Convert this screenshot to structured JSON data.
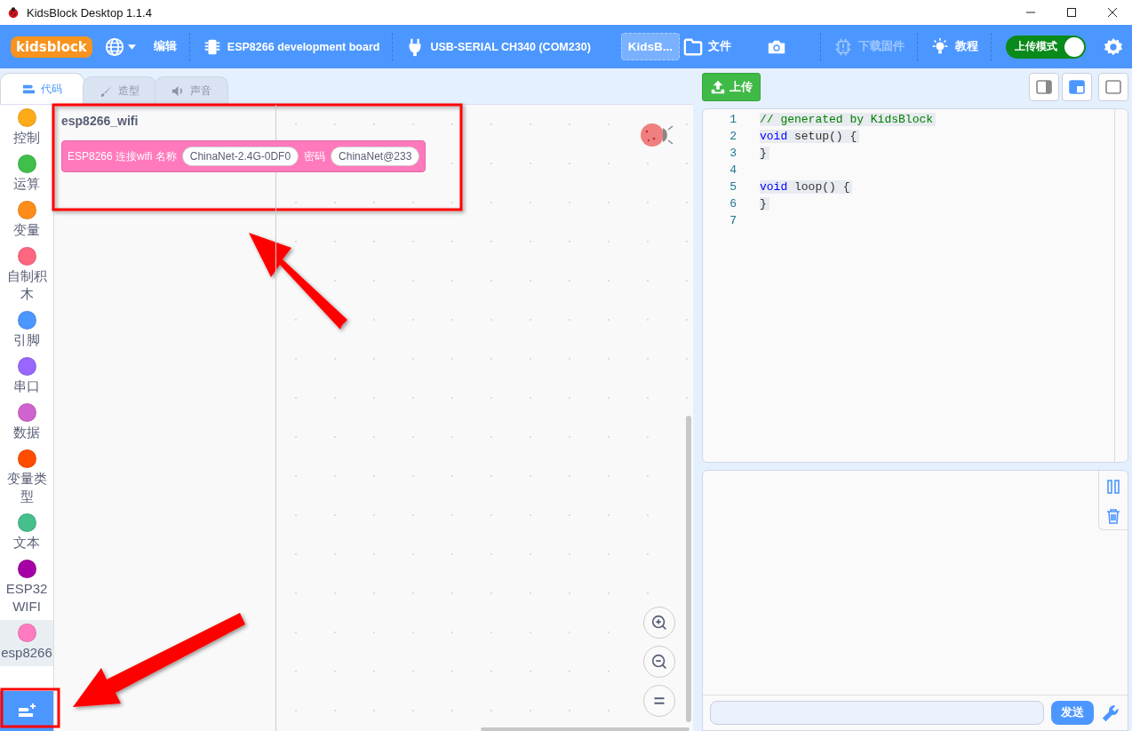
{
  "window": {
    "title": "KidsBlock Desktop 1.1.4"
  },
  "menu_bar": {
    "logo": "kidsblock",
    "edit": "编辑",
    "board": "ESP8266 development board",
    "port": "USB-SERIAL CH340 (COM230)",
    "project_name": "KidsB...",
    "file": "文件",
    "firmware": {
      "label": "下载固件",
      "disabled": true
    },
    "tutorial": "教程",
    "upload_mode": {
      "label": "上传模式",
      "on": true
    }
  },
  "tabs": [
    {
      "label": "代码",
      "selected": true
    },
    {
      "label": "造型",
      "selected": false
    },
    {
      "label": "声音",
      "selected": false
    }
  ],
  "categories": [
    {
      "label": "控制",
      "color": "#ffab19",
      "selected": false
    },
    {
      "label": "运算",
      "color": "#40bf4a",
      "selected": false
    },
    {
      "label": "变量",
      "color": "#ff8c1a",
      "selected": false
    },
    {
      "label": "自制积木",
      "color": "#ff6680",
      "selected": false
    },
    {
      "label": "引脚",
      "color": "#4c97ff",
      "selected": false
    },
    {
      "label": "串口",
      "color": "#9966ff",
      "selected": false
    },
    {
      "label": "数据",
      "color": "#cf63cf",
      "selected": false
    },
    {
      "label": "变量类型",
      "color": "#ff4d00",
      "selected": false
    },
    {
      "label": "文本",
      "color": "#45bf8c",
      "selected": false
    },
    {
      "label": "ESP32 WIFI",
      "color": "#a500a5",
      "selected": false
    },
    {
      "label": "esp8266",
      "color": "#ff7bbf",
      "selected": true
    }
  ],
  "flyout": {
    "title": "esp8266_wifi",
    "block": {
      "parts": [
        {
          "kind": "label",
          "text": "ESP8266 连接wifi 名称"
        },
        {
          "kind": "input",
          "text": "ChinaNet-2.4G-0DF0"
        },
        {
          "kind": "label",
          "text": "密码"
        },
        {
          "kind": "input",
          "text": "ChinaNet@233"
        }
      ]
    }
  },
  "upload_button": "上传",
  "layout_buttons": [
    {
      "selected": false
    },
    {
      "selected": true
    },
    {
      "selected": false
    }
  ],
  "code": [
    {
      "number": "1",
      "segments": [
        {
          "kind": "comment",
          "text": "// generated by KidsBlock"
        }
      ]
    },
    {
      "number": "2",
      "segments": [
        {
          "kind": "keyword",
          "text": "void"
        },
        {
          "kind": "plain",
          "text": " setup() {"
        }
      ]
    },
    {
      "number": "3",
      "segments": [
        {
          "kind": "plain",
          "text": "}"
        }
      ]
    },
    {
      "number": "4"
    },
    {
      "number": "5",
      "segments": [
        {
          "kind": "keyword",
          "text": "void"
        },
        {
          "kind": "plain",
          "text": " loop() {"
        }
      ]
    },
    {
      "number": "6",
      "segments": [
        {
          "kind": "plain",
          "text": "}"
        }
      ]
    },
    {
      "number": "7"
    }
  ],
  "serial": {
    "send_button": "发送"
  }
}
